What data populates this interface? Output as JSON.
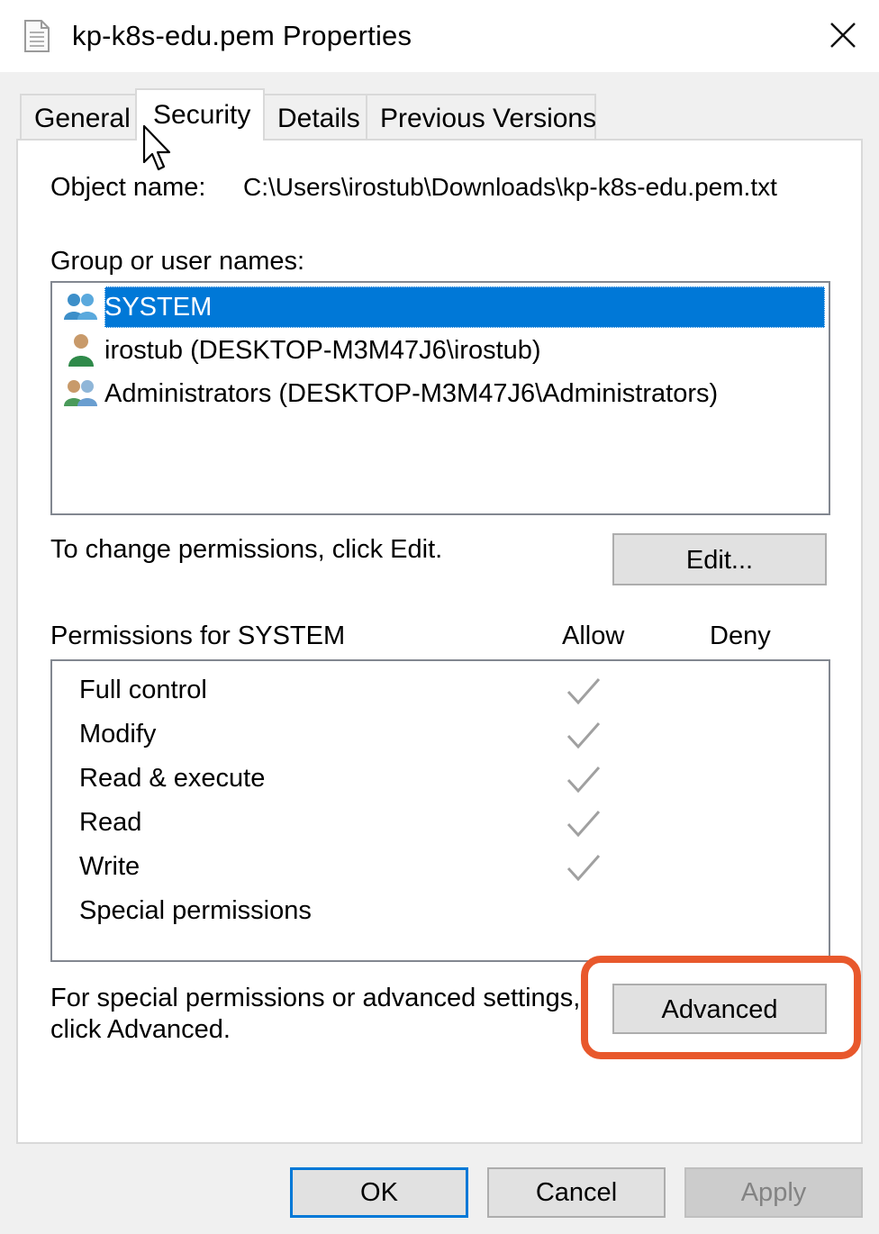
{
  "window": {
    "title": "kp-k8s-edu.pem Properties",
    "icon": "document-icon",
    "close_icon": "close-icon"
  },
  "tabs": [
    {
      "label": "General",
      "active": false
    },
    {
      "label": "Security",
      "active": true
    },
    {
      "label": "Details",
      "active": false
    },
    {
      "label": "Previous Versions",
      "active": false
    }
  ],
  "security": {
    "object_name_label": "Object name:",
    "object_name_value": "C:\\Users\\irostub\\Downloads\\kp-k8s-edu.pem.txt",
    "group_label": "Group or user names:",
    "users": [
      {
        "name": "SYSTEM",
        "icon": "users-group-icon",
        "selected": true
      },
      {
        "name": "irostub (DESKTOP-M3M47J6\\irostub)",
        "icon": "user-icon",
        "selected": false
      },
      {
        "name": "Administrators (DESKTOP-M3M47J6\\Administrators)",
        "icon": "admin-group-icon",
        "selected": false
      }
    ],
    "change_hint": "To change permissions, click Edit.",
    "edit_button": "Edit...",
    "permissions_label": "Permissions for SYSTEM",
    "allow_header": "Allow",
    "deny_header": "Deny",
    "permissions": [
      {
        "name": "Full control",
        "allow": true,
        "deny": false
      },
      {
        "name": "Modify",
        "allow": true,
        "deny": false
      },
      {
        "name": "Read & execute",
        "allow": true,
        "deny": false
      },
      {
        "name": "Read",
        "allow": true,
        "deny": false
      },
      {
        "name": "Write",
        "allow": true,
        "deny": false
      },
      {
        "name": "Special permissions",
        "allow": false,
        "deny": false
      }
    ],
    "advanced_hint_line1": "For special permissions or advanced settings,",
    "advanced_hint_line2": "click Advanced.",
    "advanced_button": "Advanced"
  },
  "footer": {
    "ok": "OK",
    "cancel": "Cancel",
    "apply": "Apply"
  },
  "colors": {
    "selection": "#0078d7",
    "highlight": "#e8582c",
    "check": "#a0a0a0"
  }
}
